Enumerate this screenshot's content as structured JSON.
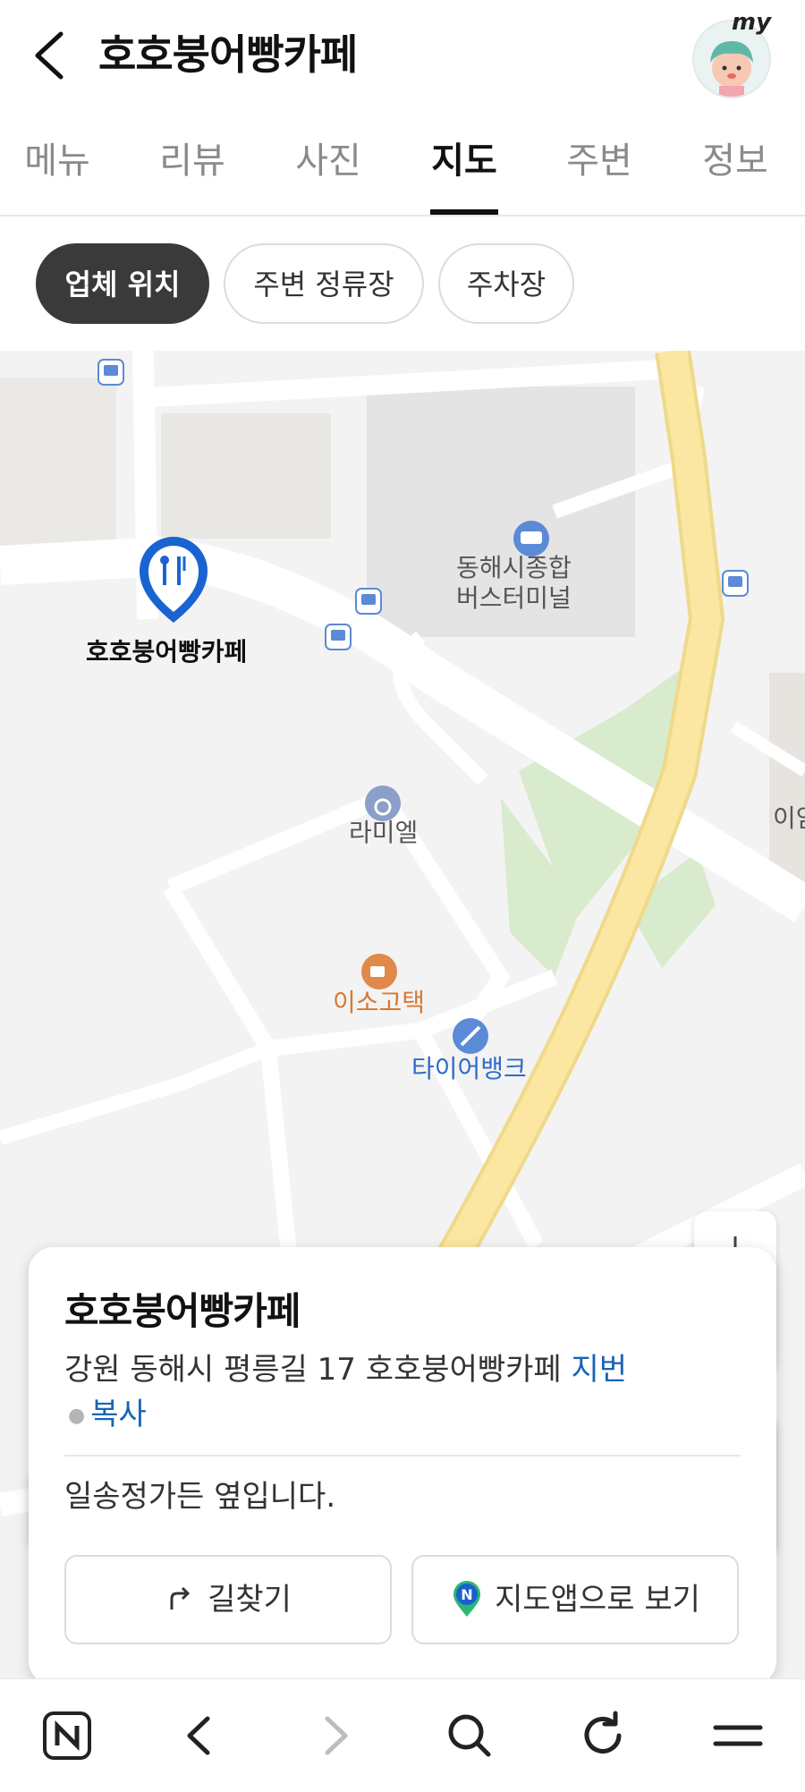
{
  "header": {
    "title": "호호붕어빵카페",
    "avatar_label": "my"
  },
  "tabs": [
    {
      "label": "메뉴",
      "active": false
    },
    {
      "label": "리뷰",
      "active": false
    },
    {
      "label": "사진",
      "active": false
    },
    {
      "label": "지도",
      "active": true
    },
    {
      "label": "주변",
      "active": false
    },
    {
      "label": "정보",
      "active": false
    }
  ],
  "chips": [
    {
      "label": "업체 위치",
      "active": true
    },
    {
      "label": "주변 정류장",
      "active": false
    },
    {
      "label": "주차장",
      "active": false
    }
  ],
  "map": {
    "pin_label": "호호붕어빵카페",
    "poi": {
      "terminal": "동해시종합\n버스터미널",
      "ramiel": "라미엘",
      "isogotaek": "이소고택",
      "tirebank": "타이어뱅크",
      "edge_label": "이암"
    },
    "colors": {
      "main_road": "#fbe7a1",
      "park": "#d8ebcd",
      "pin": "#1a64d2",
      "cafe_poi": "#e0894a",
      "service_poi": "#5b8ad6",
      "bus": "#5b8ad6"
    },
    "icons": [
      "fork-knife-icon",
      "bus-stop-icon",
      "bus-terminal-icon",
      "ring-icon",
      "coffee-icon",
      "wrench-icon",
      "plus-icon",
      "minus-icon",
      "crosshair-icon"
    ]
  },
  "card": {
    "title": "호호붕어빵카페",
    "address": "강원 동해시 평릉길 17 호호붕어빵카페",
    "jibun_link": "지번",
    "copy_link": "복사",
    "description": "일송정가든 옆입니다.",
    "directions_label": "길찾기",
    "mapapp_label": "지도앱으로 보기"
  },
  "bottom_bar": {
    "icons": [
      "naver-n-icon",
      "back-arrow-icon",
      "forward-arrow-icon",
      "search-icon",
      "refresh-icon",
      "menu-icon"
    ]
  }
}
